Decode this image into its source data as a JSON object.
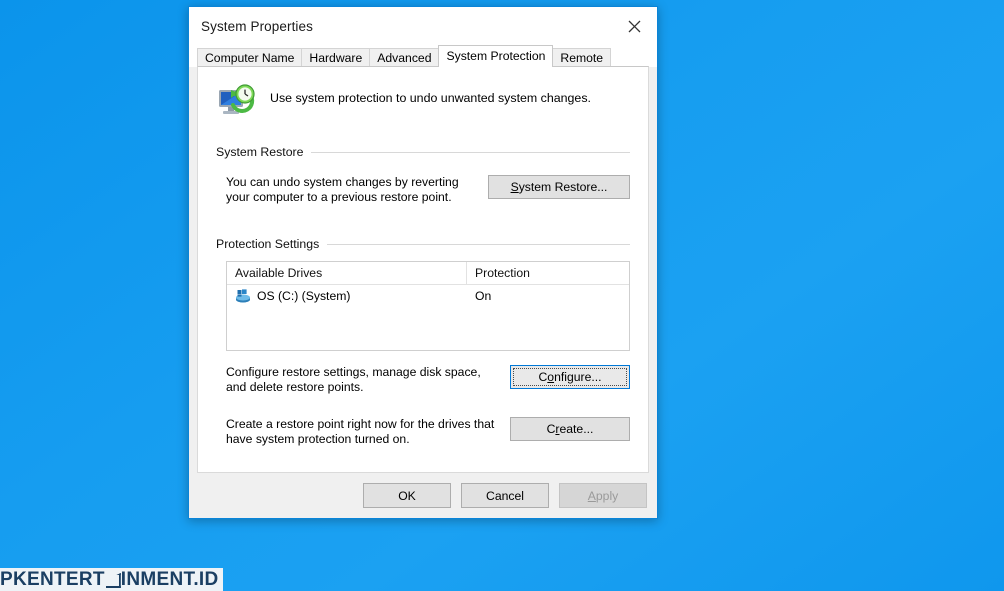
{
  "desktop": {
    "background_color_top": "#0b94eb",
    "background_color_bottom": "#0f97ed"
  },
  "dialog": {
    "title": "System Properties",
    "close_icon": "close-icon",
    "tabs": [
      {
        "label": "Computer Name",
        "active": false
      },
      {
        "label": "Hardware",
        "active": false
      },
      {
        "label": "Advanced",
        "active": false
      },
      {
        "label": "System Protection",
        "active": true
      },
      {
        "label": "Remote",
        "active": false
      }
    ],
    "intro": {
      "icon": "system-protection-icon",
      "text": "Use system protection to undo unwanted system changes."
    },
    "system_restore": {
      "group_title": "System Restore",
      "description": "You can undo system changes by reverting your computer to a previous restore point.",
      "button": {
        "accesskey": "S",
        "rest": "ystem Restore...",
        "full_label": "System Restore..."
      }
    },
    "protection_settings": {
      "group_title": "Protection Settings",
      "columns": [
        "Available Drives",
        "Protection"
      ],
      "rows": [
        {
          "drive_icon": "hard-drive-icon",
          "drive": "OS (C:) (System)",
          "protection": "On"
        }
      ],
      "configure": {
        "description": "Configure restore settings, manage disk space, and delete restore points.",
        "button": {
          "prefix": "C",
          "accesskey": "o",
          "rest": "nfigure...",
          "full_label": "Configure...",
          "focused": true
        }
      },
      "create": {
        "description": "Create a restore point right now for the drives that have system protection turned on.",
        "button": {
          "prefix": "C",
          "accesskey": "r",
          "rest": "eate...",
          "full_label": "Create..."
        }
      }
    },
    "footer": {
      "ok": "OK",
      "cancel": "Cancel",
      "apply": {
        "accesskey": "A",
        "rest": "pply",
        "full_label": "Apply",
        "disabled": true
      }
    }
  },
  "watermark": {
    "part1": "PKENTERT",
    "glyph": "stylized-a-glyph",
    "part2": "INMENT.ID"
  }
}
